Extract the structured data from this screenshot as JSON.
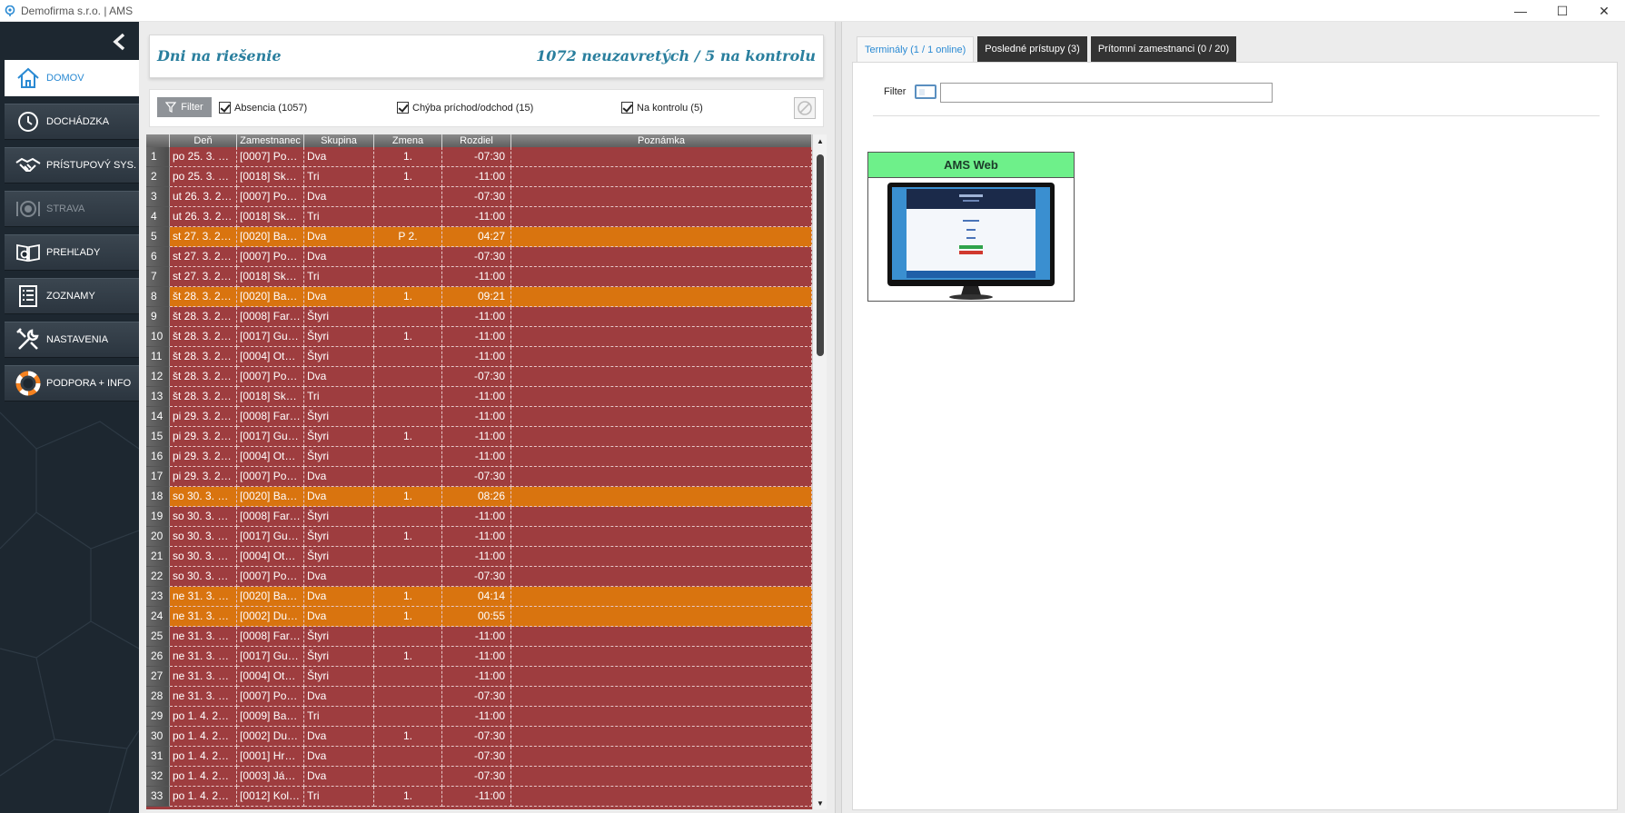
{
  "window": {
    "title": "Demofirma s.r.o. | AMS",
    "minimize": "—",
    "maximize": "☐",
    "close": "✕"
  },
  "sidebar": {
    "items": [
      {
        "label": "DOMOV",
        "icon": "home-icon",
        "state": "active"
      },
      {
        "label": "DOCHÁDZKA",
        "icon": "clock-icon",
        "state": "normal"
      },
      {
        "label": "PRÍSTUPOVÝ SYS.",
        "icon": "handshake-icon",
        "state": "normal"
      },
      {
        "label": "STRAVA",
        "icon": "plate-icon",
        "state": "disabled"
      },
      {
        "label": "PREHĽADY",
        "icon": "book-search-icon",
        "state": "normal"
      },
      {
        "label": "ZOZNAMY",
        "icon": "list-icon",
        "state": "normal"
      },
      {
        "label": "NASTAVENIA",
        "icon": "tools-icon",
        "state": "normal"
      },
      {
        "label": "PODPORA + INFO",
        "icon": "lifebuoy-icon",
        "state": "normal"
      }
    ]
  },
  "header": {
    "title": "Dni na riešenie",
    "summary": "1072 neuzavretých / 5 na kontrolu"
  },
  "filters": {
    "button": "Filter",
    "absencia": "Absencia (1057)",
    "chyba": "Chýba príchod/odchod (15)",
    "kontrola": "Na kontrolu (5)"
  },
  "grid": {
    "columns": [
      "",
      "Deň",
      "Zamestnanec",
      "Skupina",
      "Zmena",
      "Rozdiel",
      "Poznámka"
    ],
    "rows": [
      {
        "n": "1",
        "day": "po 25. 3. …",
        "emp": "[0007] Po…",
        "group": "Dva",
        "shift": "1.",
        "diff": "-07:30",
        "note": "",
        "kind": "red"
      },
      {
        "n": "2",
        "day": "po 25. 3. …",
        "emp": "[0018] Sk…",
        "group": "Tri",
        "shift": "1.",
        "diff": "-11:00",
        "note": "",
        "kind": "red"
      },
      {
        "n": "3",
        "day": "ut 26. 3. 2…",
        "emp": "[0007] Po…",
        "group": "Dva",
        "shift": "",
        "diff": "-07:30",
        "note": "",
        "kind": "red"
      },
      {
        "n": "4",
        "day": "ut 26. 3. 2…",
        "emp": "[0018] Sk…",
        "group": "Tri",
        "shift": "",
        "diff": "-11:00",
        "note": "",
        "kind": "red"
      },
      {
        "n": "5",
        "day": "st 27. 3. 2…",
        "emp": "[0020] Ba…",
        "group": "Dva",
        "shift": "P 2.",
        "diff": "04:27",
        "note": "",
        "kind": "orange"
      },
      {
        "n": "6",
        "day": "st 27. 3. 2…",
        "emp": "[0007] Po…",
        "group": "Dva",
        "shift": "",
        "diff": "-07:30",
        "note": "",
        "kind": "red"
      },
      {
        "n": "7",
        "day": "st 27. 3. 2…",
        "emp": "[0018] Sk…",
        "group": "Tri",
        "shift": "",
        "diff": "-11:00",
        "note": "",
        "kind": "red"
      },
      {
        "n": "8",
        "day": "št 28. 3. 2…",
        "emp": "[0020] Ba…",
        "group": "Dva",
        "shift": "1.",
        "diff": "09:21",
        "note": "",
        "kind": "orange"
      },
      {
        "n": "9",
        "day": "št 28. 3. 2…",
        "emp": "[0008] Far…",
        "group": "Štyri",
        "shift": "",
        "diff": "-11:00",
        "note": "",
        "kind": "red"
      },
      {
        "n": "10",
        "day": "št 28. 3. 2…",
        "emp": "[0017] Gu…",
        "group": "Štyri",
        "shift": "1.",
        "diff": "-11:00",
        "note": "",
        "kind": "red"
      },
      {
        "n": "11",
        "day": "št 28. 3. 2…",
        "emp": "[0004] Ot…",
        "group": "Štyri",
        "shift": "",
        "diff": "-11:00",
        "note": "",
        "kind": "red"
      },
      {
        "n": "12",
        "day": "št 28. 3. 2…",
        "emp": "[0007] Po…",
        "group": "Dva",
        "shift": "",
        "diff": "-07:30",
        "note": "",
        "kind": "red"
      },
      {
        "n": "13",
        "day": "št 28. 3. 2…",
        "emp": "[0018] Sk…",
        "group": "Tri",
        "shift": "",
        "diff": "-11:00",
        "note": "",
        "kind": "red"
      },
      {
        "n": "14",
        "day": "pi 29. 3. 2…",
        "emp": "[0008] Far…",
        "group": "Štyri",
        "shift": "",
        "diff": "-11:00",
        "note": "",
        "kind": "red"
      },
      {
        "n": "15",
        "day": "pi 29. 3. 2…",
        "emp": "[0017] Gu…",
        "group": "Štyri",
        "shift": "1.",
        "diff": "-11:00",
        "note": "",
        "kind": "red"
      },
      {
        "n": "16",
        "day": "pi 29. 3. 2…",
        "emp": "[0004] Ot…",
        "group": "Štyri",
        "shift": "",
        "diff": "-11:00",
        "note": "",
        "kind": "red"
      },
      {
        "n": "17",
        "day": "pi 29. 3. 2…",
        "emp": "[0007] Po…",
        "group": "Dva",
        "shift": "",
        "diff": "-07:30",
        "note": "",
        "kind": "red"
      },
      {
        "n": "18",
        "day": "so 30. 3. …",
        "emp": "[0020] Ba…",
        "group": "Dva",
        "shift": "1.",
        "diff": "08:26",
        "note": "",
        "kind": "orange"
      },
      {
        "n": "19",
        "day": "so 30. 3. …",
        "emp": "[0008] Far…",
        "group": "Štyri",
        "shift": "",
        "diff": "-11:00",
        "note": "",
        "kind": "red"
      },
      {
        "n": "20",
        "day": "so 30. 3. …",
        "emp": "[0017] Gu…",
        "group": "Štyri",
        "shift": "1.",
        "diff": "-11:00",
        "note": "",
        "kind": "red"
      },
      {
        "n": "21",
        "day": "so 30. 3. …",
        "emp": "[0004] Ot…",
        "group": "Štyri",
        "shift": "",
        "diff": "-11:00",
        "note": "",
        "kind": "red"
      },
      {
        "n": "22",
        "day": "so 30. 3. …",
        "emp": "[0007] Po…",
        "group": "Dva",
        "shift": "",
        "diff": "-07:30",
        "note": "",
        "kind": "red"
      },
      {
        "n": "23",
        "day": "ne 31. 3. …",
        "emp": "[0020] Ba…",
        "group": "Dva",
        "shift": "1.",
        "diff": "04:14",
        "note": "",
        "kind": "orange"
      },
      {
        "n": "24",
        "day": "ne 31. 3. …",
        "emp": "[0002] Du…",
        "group": "Dva",
        "shift": "1.",
        "diff": "00:55",
        "note": "",
        "kind": "orange"
      },
      {
        "n": "25",
        "day": "ne 31. 3. …",
        "emp": "[0008] Far…",
        "group": "Štyri",
        "shift": "",
        "diff": "-11:00",
        "note": "",
        "kind": "red"
      },
      {
        "n": "26",
        "day": "ne 31. 3. …",
        "emp": "[0017] Gu…",
        "group": "Štyri",
        "shift": "1.",
        "diff": "-11:00",
        "note": "",
        "kind": "red"
      },
      {
        "n": "27",
        "day": "ne 31. 3. …",
        "emp": "[0004] Ot…",
        "group": "Štyri",
        "shift": "",
        "diff": "-11:00",
        "note": "",
        "kind": "red"
      },
      {
        "n": "28",
        "day": "ne 31. 3. …",
        "emp": "[0007] Po…",
        "group": "Dva",
        "shift": "",
        "diff": "-07:30",
        "note": "",
        "kind": "red"
      },
      {
        "n": "29",
        "day": "po 1. 4. 2…",
        "emp": "[0009] Ba…",
        "group": "Tri",
        "shift": "",
        "diff": "-11:00",
        "note": "",
        "kind": "red"
      },
      {
        "n": "30",
        "day": "po 1. 4. 2…",
        "emp": "[0002] Du…",
        "group": "Dva",
        "shift": "1.",
        "diff": "-07:30",
        "note": "",
        "kind": "red"
      },
      {
        "n": "31",
        "day": "po 1. 4. 2…",
        "emp": "[0001] Hr…",
        "group": "Dva",
        "shift": "",
        "diff": "-07:30",
        "note": "",
        "kind": "red"
      },
      {
        "n": "32",
        "day": "po 1. 4. 2…",
        "emp": "[0003] Já…",
        "group": "Dva",
        "shift": "",
        "diff": "-07:30",
        "note": "",
        "kind": "red"
      },
      {
        "n": "33",
        "day": "po 1. 4. 2…",
        "emp": "[0012] Kol…",
        "group": "Tri",
        "shift": "1.",
        "diff": "-11:00",
        "note": "",
        "kind": "red"
      }
    ]
  },
  "right": {
    "tabs": [
      {
        "label": "Terminály (1 / 1 online)",
        "active": true
      },
      {
        "label": "Posledné prístupy (3)",
        "active": false
      },
      {
        "label": "Prítomní zamestnanci (0 / 20)",
        "active": false
      }
    ],
    "filter_label": "Filter",
    "filter_value": "",
    "terminal": {
      "name": "AMS Web"
    }
  },
  "colors": {
    "row_red": "#9e3d3f",
    "row_orange": "#d9740f",
    "accent": "#2a8ad3",
    "terminal_header": "#6ef08a"
  }
}
